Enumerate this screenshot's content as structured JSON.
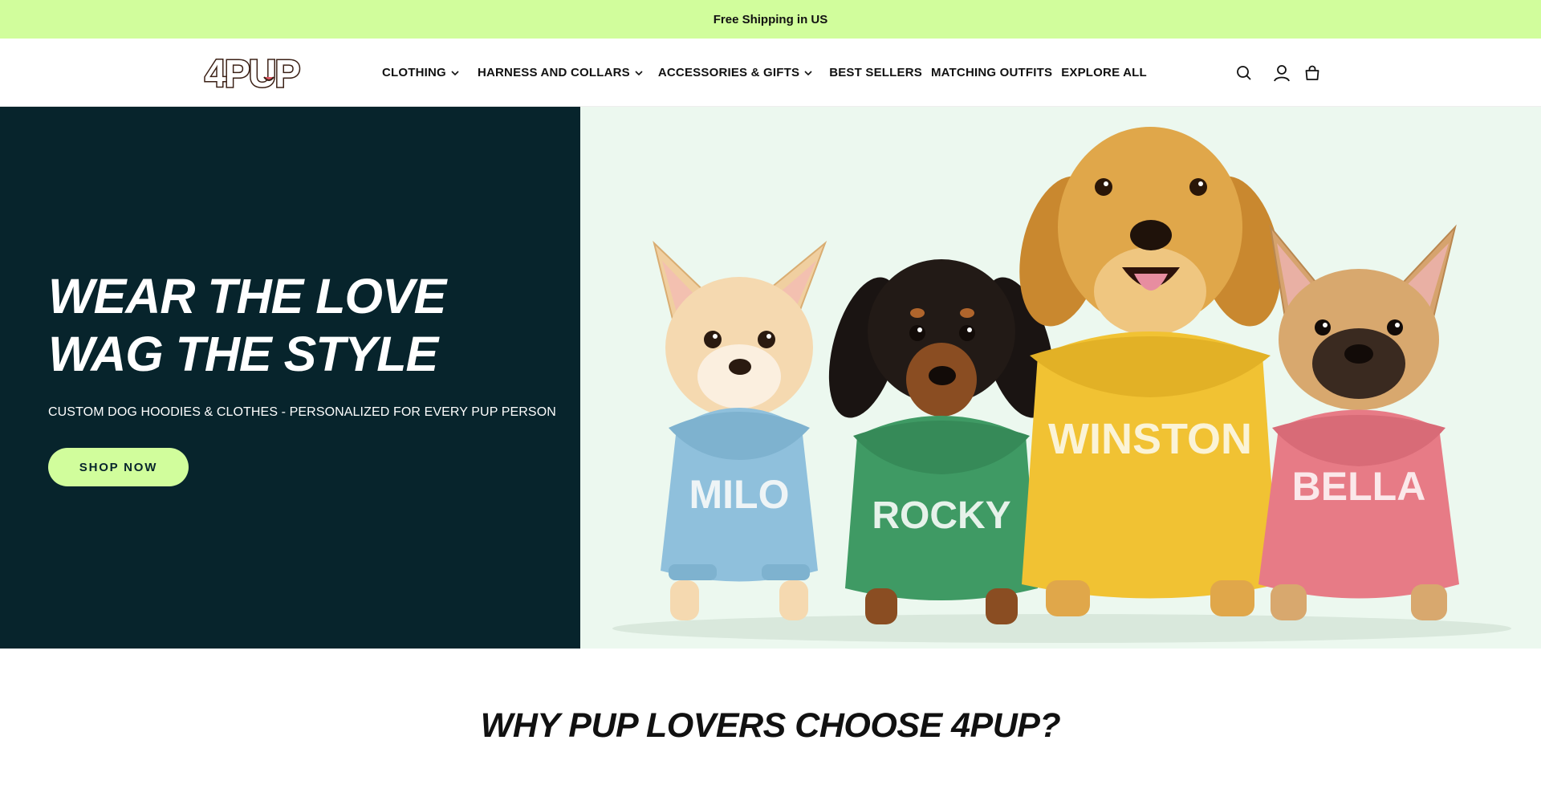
{
  "announcement": {
    "text": "Free Shipping in US"
  },
  "header": {
    "logo_text": "4PUP",
    "nav": [
      {
        "label": "CLOTHING",
        "has_dropdown": true
      },
      {
        "label": "HARNESS AND COLLARS",
        "has_dropdown": true
      },
      {
        "label": "ACCESSORIES & GIFTS",
        "has_dropdown": true
      },
      {
        "label": "BEST SELLERS",
        "has_dropdown": false
      },
      {
        "label": "MATCHING OUTFITS",
        "has_dropdown": false
      },
      {
        "label": "EXPLORE ALL",
        "has_dropdown": false
      }
    ],
    "icons": [
      "search-icon",
      "account-icon",
      "cart-icon"
    ]
  },
  "hero": {
    "title_line1": "WEAR THE LOVE",
    "title_line2": "WAG THE STYLE",
    "subtitle": "CUSTOM DOG HOODIES & CLOTHES - PERSONALIZED FOR EVERY PUP PERSON",
    "cta_label": "SHOP NOW",
    "image": {
      "dogs": [
        {
          "name": "MILO",
          "hoodie_color": "#8fc0dc"
        },
        {
          "name": "ROCKY",
          "hoodie_color": "#3f9a64"
        },
        {
          "name": "WINSTON",
          "hoodie_color": "#f1c233"
        },
        {
          "name": "BELLA",
          "hoodie_color": "#e77b86"
        }
      ]
    }
  },
  "why": {
    "heading": "WHY PUP LOVERS CHOOSE 4PUP?"
  },
  "colors": {
    "accent": "#d1fd9c",
    "hero_dark": "#07242c",
    "hero_bg": "#ecf8ef"
  }
}
